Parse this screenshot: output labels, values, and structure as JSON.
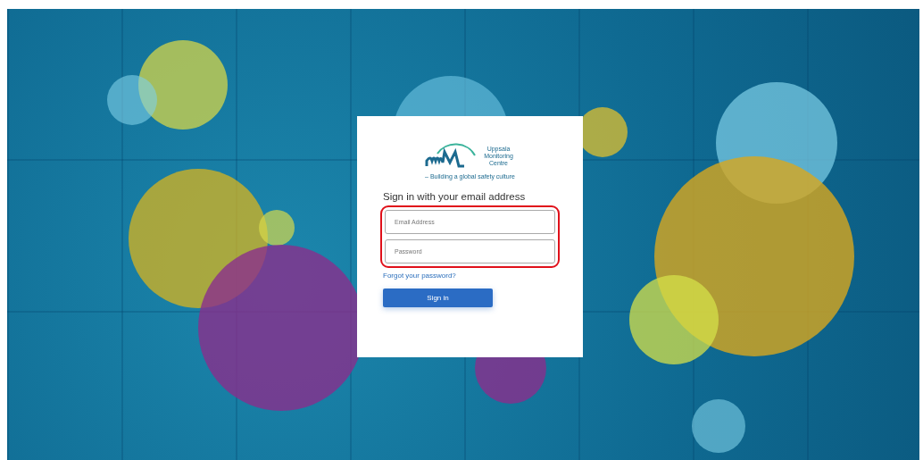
{
  "logo": {
    "name": "Uppsala Monitoring Centre",
    "tagline": "– Building a global safety culture"
  },
  "heading": "Sign in with your email address",
  "fields": [
    {
      "placeholder": "Email Address"
    },
    {
      "placeholder": "Password"
    }
  ],
  "fields_highlighted": true,
  "forgot_link": "Forgot your password?",
  "button": "Sign in"
}
